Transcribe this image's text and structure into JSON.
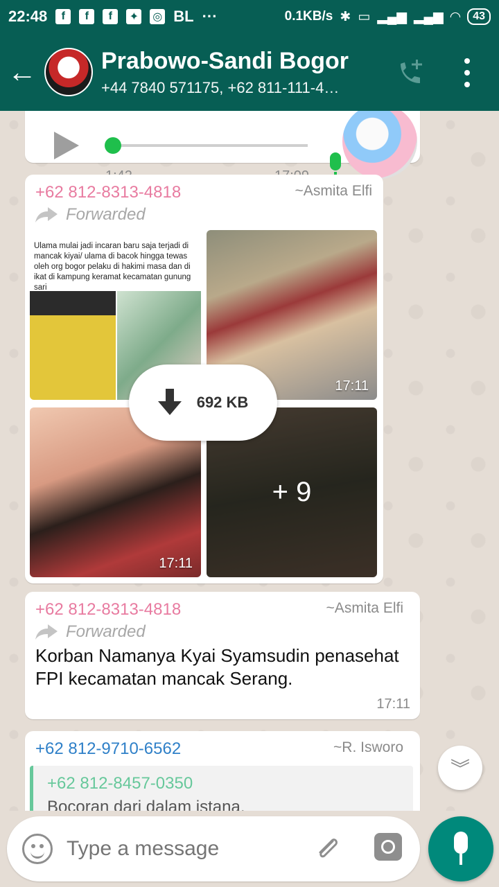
{
  "status_bar": {
    "time": "22:48",
    "carrier": "BL",
    "dots": "···",
    "net_speed": "0.1KB/s",
    "battery": "43"
  },
  "header": {
    "title": "Prabowo-Sandi  Bogor",
    "subtitle": "+44 7840 571175, +62 811-111-4…"
  },
  "voice_message": {
    "duration": "1:42",
    "time": "17:09"
  },
  "media_message": {
    "sender": "+62 812-8313-4818",
    "member_name": "~Asmita Elfi",
    "forwarded": "Forwarded",
    "thumb_text": "Ulama mulai jadi incaran  baru saja terjadi di mancak kiyai/ ulama di bacok hingga tewas oleh org bogor pelaku di hakimi masa dan di ikat di kampung keramat kecamatan gunung sari",
    "time_top": "17:11",
    "time_bottom": "17:11",
    "extra_count": "+ 9",
    "download_size": "692 KB"
  },
  "text_message": {
    "sender": "+62 812-8313-4818",
    "member_name": "~Asmita Elfi",
    "forwarded": "Forwarded",
    "text": "Korban Namanya Kyai Syamsudin penasehat FPI  kecamatan mancak Serang.",
    "time": "17:11"
  },
  "quote_message": {
    "sender": "+62 812-9710-6562",
    "member_name": "~R. Isworo",
    "quoted_sender": "+62 812-8457-0350",
    "quoted_text": "Bocoran dari dalam istana."
  },
  "input": {
    "placeholder": "Type a message"
  },
  "colors": {
    "header": "#075e54",
    "accent": "#00897b",
    "sender_pink": "#e87ba0",
    "sender_blue": "#2f80c8"
  },
  "icons": [
    "back-arrow-icon",
    "add-call-icon",
    "more-vert-icon",
    "play-icon",
    "mic-icon",
    "forward-icon",
    "download-icon",
    "chevron-down-icon",
    "emoji-icon",
    "attach-icon",
    "camera-icon"
  ]
}
